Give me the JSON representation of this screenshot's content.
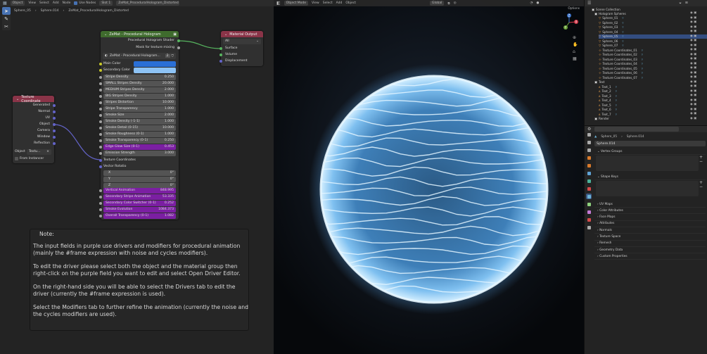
{
  "node_editor": {
    "header_menu": [
      "Object",
      "View",
      "Select",
      "Add",
      "Node"
    ],
    "use_nodes": "Use Nodes",
    "slot": "Slot 1",
    "material": "ZeMat_ProceduralHologram_Distorted",
    "breadcrumb": [
      "Sphere_05",
      "Sphere.014",
      "ZeMat_ProceduralHologram_Distorted"
    ]
  },
  "texcoord_node": {
    "title": "Texture Coordinate",
    "outputs": [
      "Generated",
      "Normal",
      "UV",
      "Object",
      "Camera",
      "Window",
      "Reflection"
    ],
    "object_label": "Object",
    "object_value": "Textu...",
    "from_instancer": "From Instancer"
  },
  "zemat_node": {
    "title": "ZeMat - Procedural Hologram",
    "outputs": [
      "Procedural Hologram Shader",
      "Mask for texture mixing"
    ],
    "group_name": "ZeMat - Procedural Hologram...",
    "group_users": "2",
    "main_color": "Main Color",
    "secondary_color": "Secondary Color",
    "main_color_hex": "#2a6fd6",
    "secondary_color_hex": "#8ec3f5",
    "fields": [
      {
        "label": "Stripe Density",
        "value": "0.250",
        "kind": "g"
      },
      {
        "label": "SMALL Stripes Density",
        "value": "20.000",
        "kind": "g"
      },
      {
        "label": "MEDIUM Stripes Density",
        "value": "2.000",
        "kind": "g"
      },
      {
        "label": "BIG Stripes Density",
        "value": "1.000",
        "kind": "g"
      },
      {
        "label": "Stripes Distortion",
        "value": "10.000",
        "kind": "g"
      },
      {
        "label": "Stripe Transparency",
        "value": "1.000",
        "kind": "g"
      },
      {
        "label": "Smoke Size",
        "value": "2.000",
        "kind": "g"
      },
      {
        "label": "Smoke Density (-1-1)",
        "value": "1.000",
        "kind": "g"
      },
      {
        "label": "Smoke Detail (0-15)",
        "value": "10.000",
        "kind": "g"
      },
      {
        "label": "Smoke Roughness (0-1)",
        "value": "1.000",
        "kind": "g"
      },
      {
        "label": "Smoke Transparency (0-1)",
        "value": "0.250",
        "kind": "g"
      },
      {
        "label": "Edge Glow Size (0-1)",
        "value": "0.453",
        "kind": "p"
      },
      {
        "label": "Emission Strength",
        "value": "3.000",
        "kind": "g"
      }
    ],
    "texture_coordinates": "Texture Coordinates",
    "vector_rotation": "Vector Rotatio",
    "rotation": [
      {
        "axis": "X",
        "value": "0°"
      },
      {
        "axis": "Y",
        "value": "0°"
      },
      {
        "axis": "Z",
        "value": "0°"
      }
    ],
    "purple_fields": [
      {
        "label": "Vertical Animation",
        "value": "848.995"
      },
      {
        "label": "Secondary Stripe Animation",
        "value": "53.335"
      },
      {
        "label": "Secondary Color Switcher (0-1)",
        "value": "0.252"
      },
      {
        "label": "Smoke Evolution",
        "value": "1084.373"
      },
      {
        "label": "Overall Transparency (0-1)",
        "value": "1.082"
      }
    ]
  },
  "material_output": {
    "title": "Material Output",
    "target": "All",
    "inputs": [
      "Surface",
      "Volume",
      "Displacement"
    ]
  },
  "note": {
    "title": "Note:",
    "paragraphs": [
      "The input fields in purple use drivers and modifiers for procedural animation (mainly the #frame expression with noise and cycles modifiers).",
      "To edit the driver please select both the object and the material group then right-click on the purple field you want to edit and select Open Driver Editor.",
      "On the right-hand side you will be able to select the Drivers tab to edit the driver (currently the #frame expression is used).",
      "Select the Modifiers tab to further refine the animation (currently the noise and the cycles modifiers are used)."
    ]
  },
  "viewport": {
    "mode": "Object Mode",
    "menu": [
      "View",
      "Select",
      "Add",
      "Object"
    ],
    "transform": "Global",
    "options": "Options",
    "axes": [
      "X",
      "Y",
      "Z"
    ]
  },
  "outliner": {
    "title": "Scene Collection",
    "items": [
      {
        "name": "Hologram Spheres",
        "indent": 0,
        "hl": false
      },
      {
        "name": "Sphere_01",
        "indent": 1,
        "hl": false
      },
      {
        "name": "Sphere_02",
        "indent": 1,
        "hl": false
      },
      {
        "name": "Sphere_03",
        "indent": 1,
        "hl": false
      },
      {
        "name": "Sphere_04",
        "indent": 1,
        "hl": false
      },
      {
        "name": "Sphere_05",
        "indent": 1,
        "hl": true
      },
      {
        "name": "Sphere_06",
        "indent": 1,
        "hl": false
      },
      {
        "name": "Sphere_07",
        "indent": 1,
        "hl": false
      },
      {
        "name": "Texture Coordinates_01",
        "indent": 1,
        "hl": false
      },
      {
        "name": "Texture Coordinates_02",
        "indent": 1,
        "hl": false
      },
      {
        "name": "Texture Coordinates_03",
        "indent": 1,
        "hl": false
      },
      {
        "name": "Texture Coordinates_04",
        "indent": 1,
        "hl": false
      },
      {
        "name": "Texture Coordinates_05",
        "indent": 1,
        "hl": false
      },
      {
        "name": "Texture Coordinates_06",
        "indent": 1,
        "hl": false
      },
      {
        "name": "Texture Coordinates_07",
        "indent": 1,
        "hl": false
      },
      {
        "name": "Text",
        "indent": 0,
        "hl": false
      },
      {
        "name": "Text_1",
        "indent": 1,
        "hl": false
      },
      {
        "name": "Text_2",
        "indent": 1,
        "hl": false
      },
      {
        "name": "Text_3",
        "indent": 1,
        "hl": false
      },
      {
        "name": "Text_4",
        "indent": 1,
        "hl": false
      },
      {
        "name": "Text_5",
        "indent": 1,
        "hl": false
      },
      {
        "name": "Text_6",
        "indent": 1,
        "hl": false
      },
      {
        "name": "Text_7",
        "indent": 1,
        "hl": false
      },
      {
        "name": "Render",
        "indent": 0,
        "hl": false
      }
    ]
  },
  "properties": {
    "breadcrumb": [
      "Sphere_05",
      "Sphere.014"
    ],
    "mesh_name": "Sphere.014",
    "vertex_groups": "Vertex Groups",
    "shape_keys": "Shape Keys",
    "sections": [
      "UV Maps",
      "Color Attributes",
      "Face Maps",
      "Attributes",
      "Normals",
      "Texture Space",
      "Remesh",
      "Geometry Data",
      "Custom Properties"
    ]
  }
}
